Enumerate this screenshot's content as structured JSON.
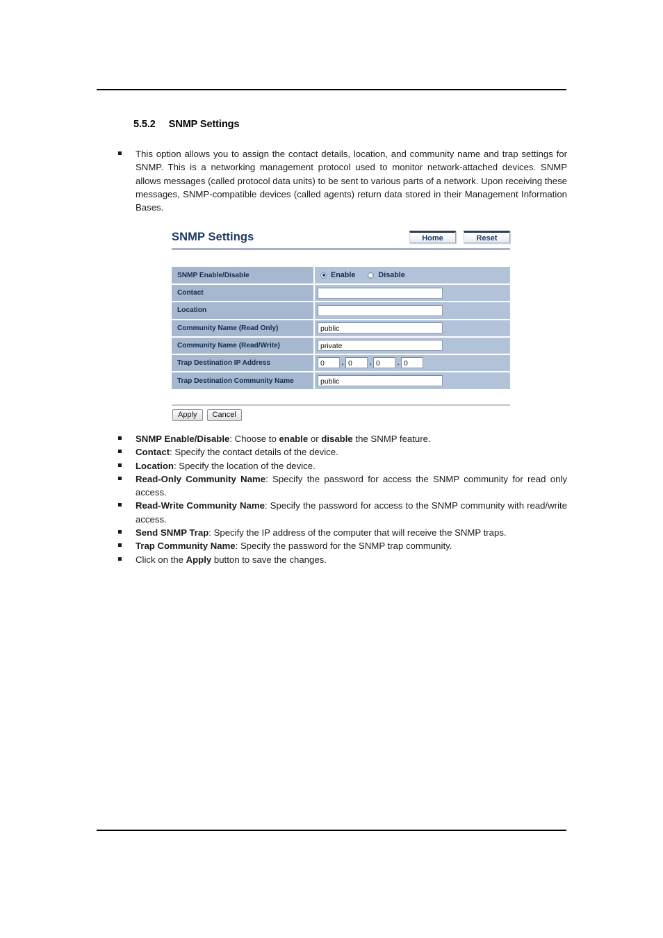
{
  "document": {
    "section_number": "5.5.2",
    "section_title": "SNMP Settings",
    "intro_paragraph": "This option allows you to assign the contact details, location, and community name and trap settings for SNMP. This is a networking management protocol used to monitor network-attached devices. SNMP allows messages (called protocol data units) to be sent to various parts of a network. Upon receiving these messages, SNMP-compatible devices (called agents) return data stored in their Management Information Bases."
  },
  "ui": {
    "title": "SNMP Settings",
    "buttons": {
      "home": "Home",
      "reset": "Reset"
    },
    "rows": [
      {
        "label": "SNMP Enable/Disable",
        "type": "radio",
        "options": [
          {
            "label": "Enable",
            "selected": true
          },
          {
            "label": "Disable",
            "selected": false
          }
        ]
      },
      {
        "label": "Contact",
        "type": "text",
        "value": ""
      },
      {
        "label": "Location",
        "type": "text",
        "value": ""
      },
      {
        "label": "Community Name (Read Only)",
        "type": "text",
        "value": "public"
      },
      {
        "label": "Community Name (Read/Write)",
        "type": "text",
        "value": "private"
      },
      {
        "label": "Trap Destination IP Address",
        "type": "ip",
        "octets": [
          "0",
          "0",
          "0",
          "0"
        ],
        "separator": "."
      },
      {
        "label": "Trap Destination Community Name",
        "type": "text",
        "value": "public"
      }
    ],
    "actions": {
      "apply": "Apply",
      "cancel": "Cancel"
    }
  },
  "descriptions": [
    {
      "term": "SNMP Enable/Disable",
      "sep": ": Choose to ",
      "bold_mid_1": "enable",
      "mid": " or ",
      "bold_mid_2": "disable",
      "tail": " the SNMP feature."
    },
    {
      "term": "Contact",
      "sep": ": Specify the contact details of the device."
    },
    {
      "term": "Location",
      "sep": ": Specify the location of the device."
    },
    {
      "term": "Read-Only Community Name",
      "sep": ": Specify the password for access the SNMP community for read only access."
    },
    {
      "term": "Read-Write Community Name",
      "sep": ": Specify the password for access to the SNMP community with read/write access."
    },
    {
      "term": "Send SNMP Trap",
      "sep": ": Specify the IP address of the computer that will receive the SNMP traps."
    },
    {
      "term": "Trap Community Name",
      "sep": ": Specify the password for the SNMP trap community."
    },
    {
      "prefix": "Click on the ",
      "term": "Apply",
      "sep": " button to save the changes."
    }
  ],
  "colors": {
    "label_cell": "#a6b8d0",
    "value_cell": "#b2c2d8",
    "ui_accent": "#1b3a63",
    "rule": "#a3b2c8"
  }
}
